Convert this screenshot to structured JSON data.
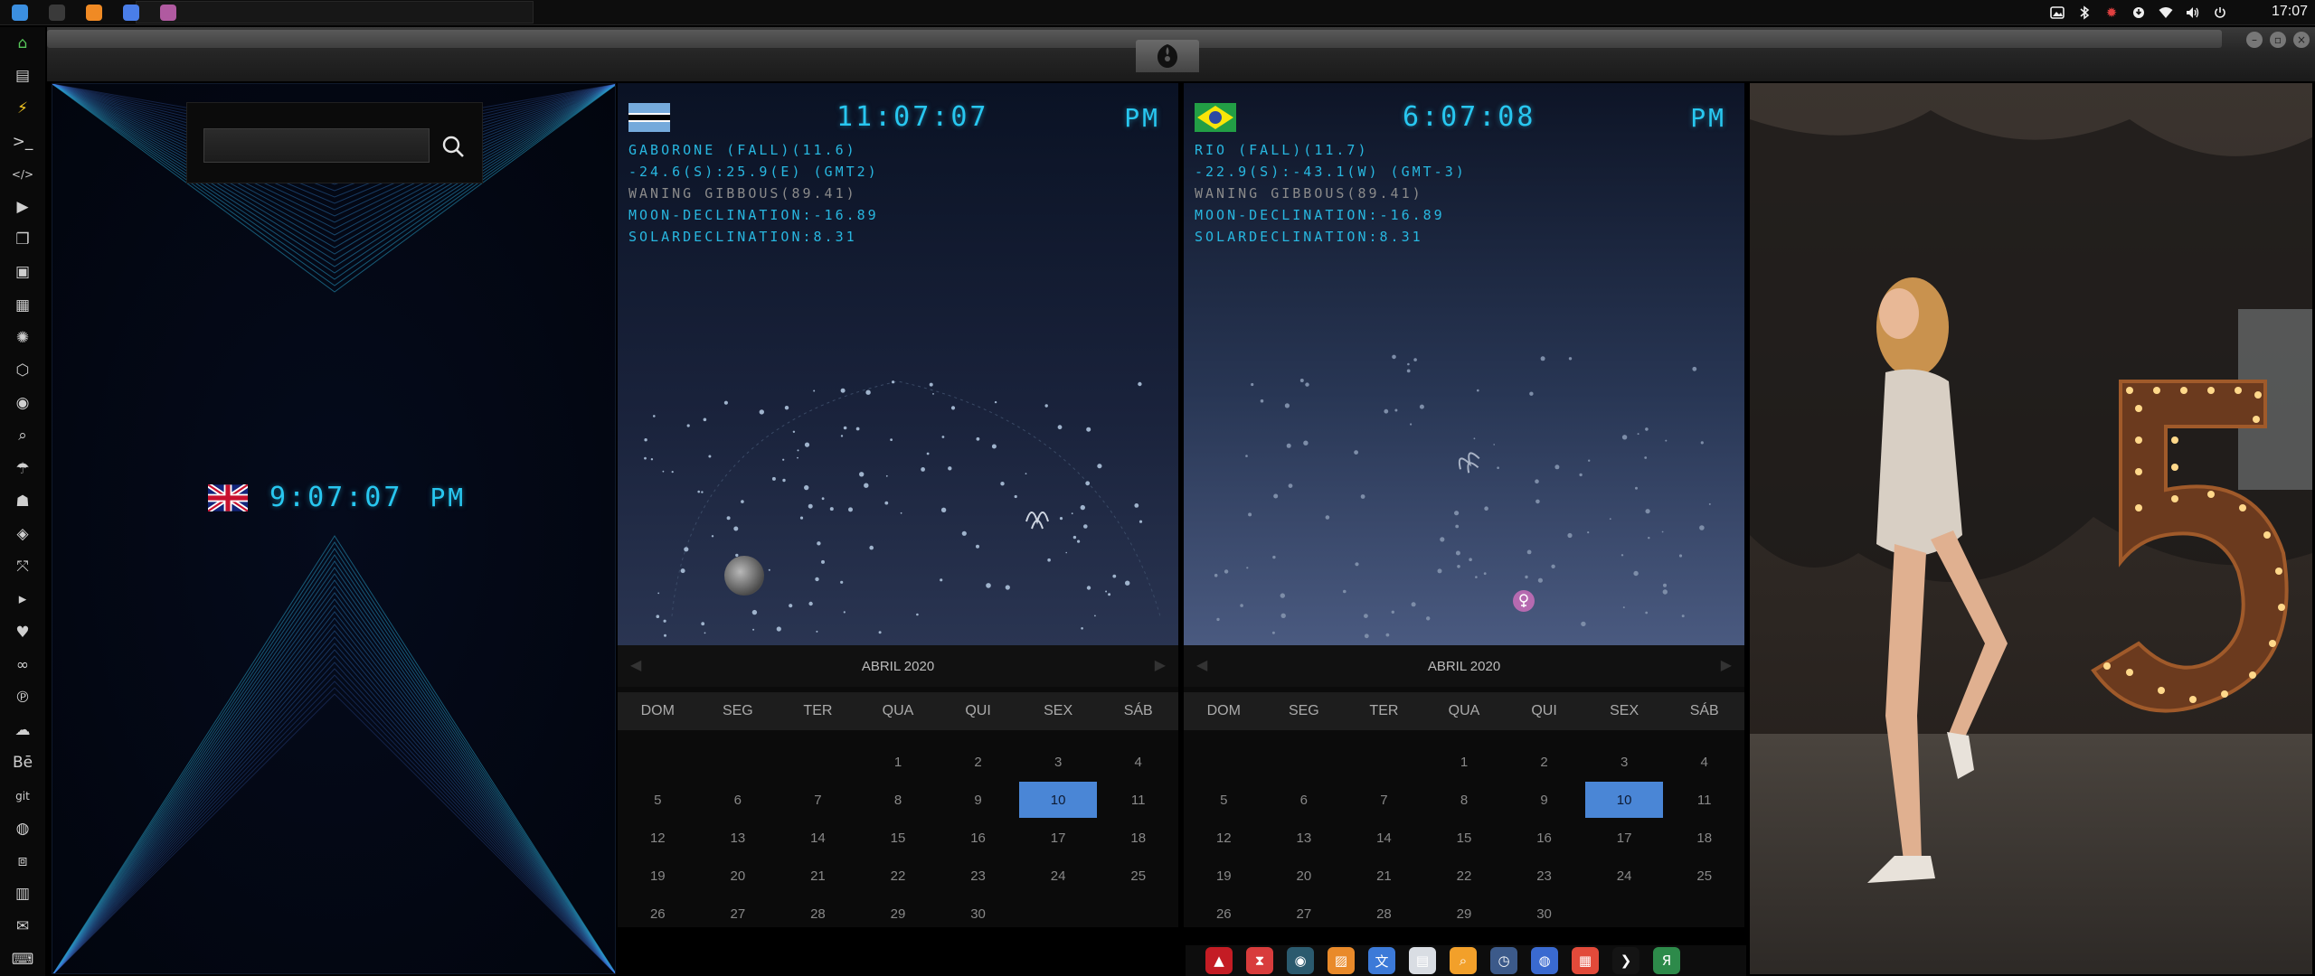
{
  "panel": {
    "apps": [
      {
        "name": "files-icon",
        "color": "#3b8fe0"
      },
      {
        "name": "terminal-icon",
        "color": "#3a3a3a"
      },
      {
        "name": "sublime-icon",
        "color": "#f08a24"
      },
      {
        "name": "chrome-icon",
        "color": "#4a7ee8"
      },
      {
        "name": "rebel-app-icon",
        "color": "#b05aa0"
      }
    ],
    "clock": "17:07"
  },
  "left_pane": {
    "search_value": "",
    "uk_time": "9:07:07",
    "uk_ampm": "PM"
  },
  "clocks": [
    {
      "time": "11:07:07",
      "ampm": "PM",
      "lines": [
        "GABORONE (FALL)(11.6)",
        "-24.6(S):25.9(E) (GMT2)",
        "WANING GIBBOUS(89.41)",
        "MOON-DECLINATION:-16.89",
        "SOLARDECLINATION:8.31"
      ],
      "calendar": {
        "month": "ABRIL 2020",
        "weekdays": [
          "DOM",
          "SEG",
          "TER",
          "QUA",
          "QUI",
          "SEX",
          "SÁB"
        ],
        "leading_blanks": 3,
        "days": [
          "1",
          "2",
          "3",
          "4",
          "5",
          "6",
          "7",
          "8",
          "9",
          "10",
          "11",
          "12",
          "13",
          "14",
          "15",
          "16",
          "17",
          "18",
          "19",
          "20",
          "21",
          "22",
          "23",
          "24",
          "25",
          "26",
          "27",
          "28",
          "29",
          "30"
        ],
        "today": "10"
      }
    },
    {
      "time": "6:07:08",
      "ampm": "PM",
      "lines": [
        "RIO (FALL)(11.7)",
        "-22.9(S):-43.1(W) (GMT-3)",
        "WANING GIBBOUS(89.41)",
        "MOON-DECLINATION:-16.89",
        "SOLARDECLINATION:8.31"
      ],
      "calendar": {
        "month": "ABRIL 2020",
        "weekdays": [
          "DOM",
          "SEG",
          "TER",
          "QUA",
          "QUI",
          "SEX",
          "SÁB"
        ],
        "leading_blanks": 3,
        "days": [
          "1",
          "2",
          "3",
          "4",
          "5",
          "6",
          "7",
          "8",
          "9",
          "10",
          "11",
          "12",
          "13",
          "14",
          "15",
          "16",
          "17",
          "18",
          "19",
          "20",
          "21",
          "22",
          "23",
          "24",
          "25",
          "26",
          "27",
          "28",
          "29",
          "30"
        ],
        "today": "10"
      }
    }
  ],
  "left_dock": [
    {
      "name": "home-icon",
      "glyph": "⌂",
      "cls": "active"
    },
    {
      "name": "document-icon",
      "glyph": "▤",
      "cls": ""
    },
    {
      "name": "bolt-icon",
      "glyph": "⚡",
      "cls": "bolt"
    },
    {
      "name": "terminal-prompt-icon",
      "glyph": ">_",
      "cls": ""
    },
    {
      "name": "code-icon",
      "glyph": "</>",
      "cls": ""
    },
    {
      "name": "play-icon",
      "glyph": "▶",
      "cls": ""
    },
    {
      "name": "copy-icon",
      "glyph": "❐",
      "cls": ""
    },
    {
      "name": "image-icon",
      "glyph": "▣",
      "cls": ""
    },
    {
      "name": "news-icon",
      "glyph": "▦",
      "cls": ""
    },
    {
      "name": "aperture-icon",
      "glyph": "✺",
      "cls": ""
    },
    {
      "name": "hexagon-icon",
      "glyph": "⬡",
      "cls": ""
    },
    {
      "name": "globe-icon",
      "glyph": "◉",
      "cls": ""
    },
    {
      "name": "search-icon",
      "glyph": "⌕",
      "cls": ""
    },
    {
      "name": "umbrella-icon",
      "glyph": "☂",
      "cls": ""
    },
    {
      "name": "contact-icon",
      "glyph": "☗",
      "cls": ""
    },
    {
      "name": "tag-icon",
      "glyph": "◈",
      "cls": ""
    },
    {
      "name": "expand-icon",
      "glyph": "⤧",
      "cls": ""
    },
    {
      "name": "youtube-icon",
      "glyph": "▸",
      "cls": ""
    },
    {
      "name": "heart-icon",
      "glyph": "♥",
      "cls": ""
    },
    {
      "name": "infinity-icon",
      "glyph": "∞",
      "cls": ""
    },
    {
      "name": "pinterest-icon",
      "glyph": "℗",
      "cls": ""
    },
    {
      "name": "cloud-icon",
      "glyph": "☁",
      "cls": ""
    },
    {
      "name": "behance-icon",
      "glyph": "Bē",
      "cls": ""
    },
    {
      "name": "git-icon",
      "glyph": "git",
      "cls": ""
    },
    {
      "name": "github-icon",
      "glyph": "◍",
      "cls": ""
    },
    {
      "name": "cubes-icon",
      "glyph": "⧈",
      "cls": ""
    },
    {
      "name": "map-icon",
      "glyph": "▥",
      "cls": ""
    },
    {
      "name": "mail-icon",
      "glyph": "✉",
      "cls": ""
    },
    {
      "name": "keyboard-icon",
      "glyph": "⌨",
      "cls": ""
    }
  ],
  "bottom_dock": [
    {
      "name": "adobe-icon",
      "glyph": "▲",
      "color": "#c41c24"
    },
    {
      "name": "timer-icon",
      "glyph": "⧗",
      "color": "#d83c3c"
    },
    {
      "name": "earth-icon",
      "glyph": "◉",
      "color": "#2b5a6e"
    },
    {
      "name": "photos-icon",
      "glyph": "▨",
      "color": "#e98a2a"
    },
    {
      "name": "translate-icon",
      "glyph": "文",
      "color": "#3c7ad8"
    },
    {
      "name": "reader-icon",
      "glyph": "▤",
      "color": "#d9dde3"
    },
    {
      "name": "magnifier-icon",
      "glyph": "⌕",
      "color": "#f2a02a"
    },
    {
      "name": "clock-app-icon",
      "glyph": "◷",
      "color": "#3c5a8a"
    },
    {
      "name": "web-icon",
      "glyph": "◍",
      "color": "#3a6ad0"
    },
    {
      "name": "calendar-app-icon",
      "glyph": "▦",
      "color": "#e24a3a"
    },
    {
      "name": "arrow-app-icon",
      "glyph": "❯",
      "color": "#141414"
    },
    {
      "name": "yandex-icon",
      "glyph": "Я",
      "color": "#2d8a4a"
    }
  ],
  "colors": {
    "accent": "#28c7f0",
    "today": "#4a86d6"
  }
}
